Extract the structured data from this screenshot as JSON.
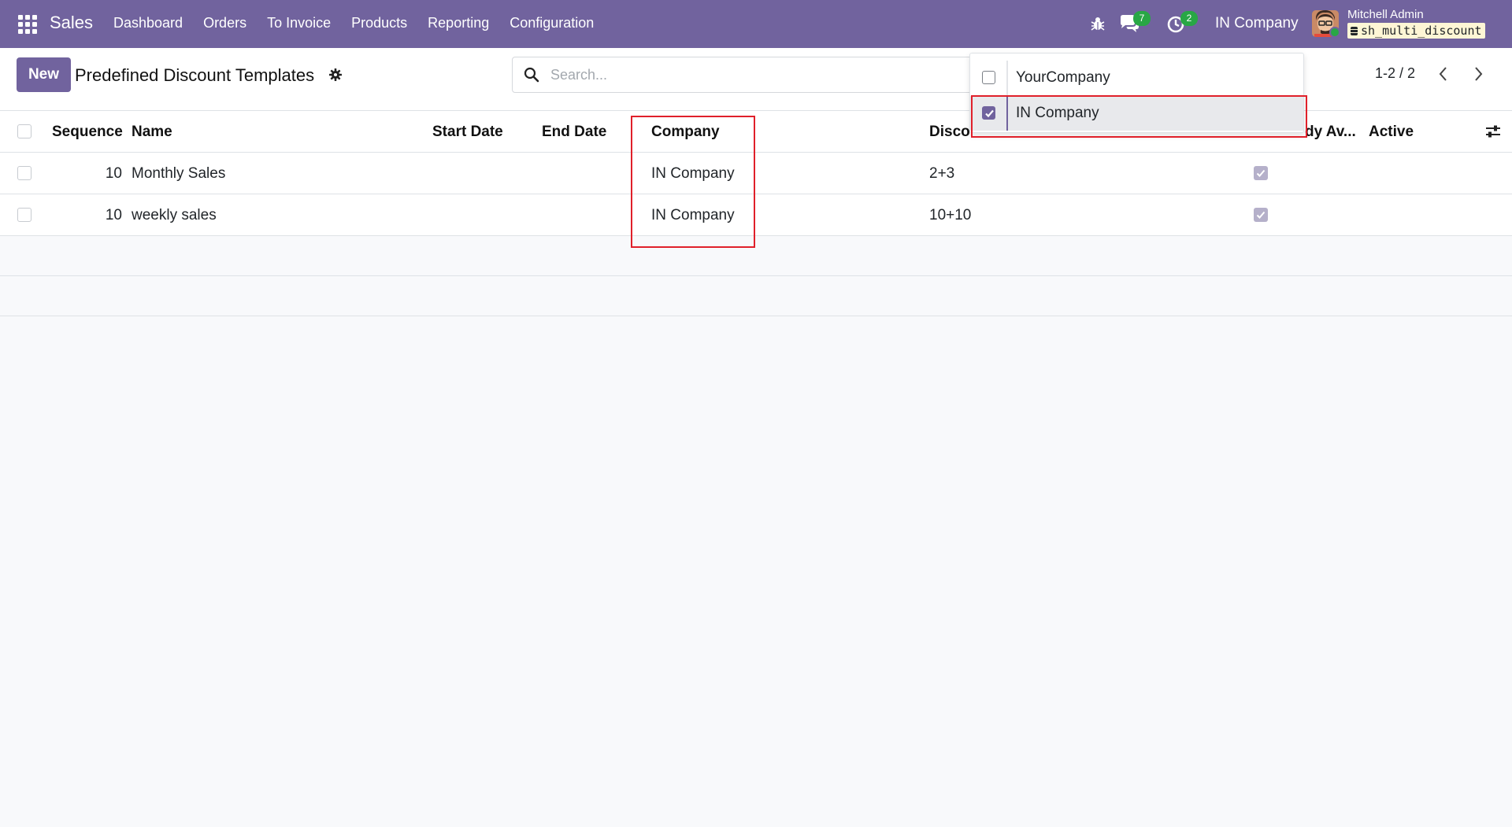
{
  "navbar": {
    "brand": "Sales",
    "menu": [
      "Dashboard",
      "Orders",
      "To Invoice",
      "Products",
      "Reporting",
      "Configuration"
    ],
    "chat_count": "7",
    "activity_count": "2",
    "company": "IN Company",
    "user_name": "Mitchell Admin",
    "db_name": "sh_multi_discount",
    "color": "#71639e"
  },
  "control_panel": {
    "new_button": "New",
    "title": "Predefined Discount Templates",
    "search_placeholder": "Search...",
    "pager": "1-2 / 2"
  },
  "company_dropdown": {
    "items": [
      {
        "label": "YourCompany",
        "checked": false
      },
      {
        "label": "IN Company",
        "checked": true
      }
    ]
  },
  "table": {
    "columns": [
      "Sequence",
      "Name",
      "Start Date",
      "End Date",
      "Company",
      "Disco",
      "dy Av...",
      "Active"
    ],
    "rows": [
      {
        "sequence": "10",
        "name": "Monthly Sales",
        "start_date": "",
        "end_date": "",
        "company": "IN Company",
        "discount": "2+3",
        "available": true
      },
      {
        "sequence": "10",
        "name": "weekly sales",
        "start_date": "",
        "end_date": "",
        "company": "IN Company",
        "discount": "10+10",
        "available": true
      }
    ]
  },
  "annotation_color": "#e0202a"
}
